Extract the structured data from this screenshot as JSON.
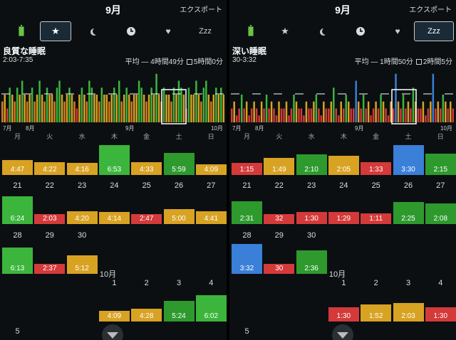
{
  "colors": {
    "green": "#3cb53c",
    "orange": "#d8a223",
    "red": "#d43a3a",
    "blue": "#3a7fd8",
    "dgreen": "#2e9a2e"
  },
  "icons": [
    "battery-icon",
    "star-icon",
    "moon-icon",
    "clock-icon",
    "heart-icon",
    "zzz-icon"
  ],
  "panels": [
    {
      "month": "9月",
      "export": "エクスポート",
      "toolbar_selected": 1,
      "zzz_label": "Zzz",
      "metric_title": "良質な睡眠",
      "range": "2:03-7:35",
      "avg_label": "平均 — 4時間49分",
      "check_label": "5時間0分",
      "chart_labels": [
        "7月",
        "8月",
        "9月",
        "10月"
      ],
      "chart_data": {
        "type": "bar",
        "palette": [
          "#3cb53c",
          "#d8a223",
          "#d87a23",
          "#d43a3a"
        ],
        "values": [
          3,
          4,
          2,
          5,
          4,
          3,
          5,
          4,
          6,
          4,
          3,
          4,
          5,
          3,
          4,
          6,
          4,
          3,
          5,
          4,
          4,
          3,
          5,
          6,
          4,
          3,
          4,
          5,
          4,
          3,
          2,
          4,
          5,
          4,
          3,
          6,
          5,
          4,
          4,
          3,
          5,
          4,
          4,
          3,
          4,
          5,
          4,
          6,
          3,
          4,
          5,
          4,
          3,
          4,
          4,
          6,
          5,
          4,
          3,
          4,
          5,
          4,
          7,
          4,
          3,
          5,
          4,
          4,
          3,
          5,
          4,
          6,
          5,
          4,
          2,
          5,
          4,
          4,
          6,
          4,
          3,
          5,
          6,
          4,
          3,
          4,
          5,
          4,
          5,
          4
        ],
        "ylim": [
          0,
          8
        ]
      },
      "daynames": [
        "月",
        "火",
        "水",
        "木",
        "金",
        "土",
        "日"
      ],
      "weeks": [
        {
          "days": [
            "",
            "",
            "",
            "",
            "",
            "",
            ""
          ],
          "values": [
            {
              "label": "4:47",
              "h": 0.47,
              "c": "orange"
            },
            {
              "label": "4:22",
              "h": 0.4,
              "c": "orange"
            },
            {
              "label": "4:16",
              "h": 0.38,
              "c": "orange"
            },
            {
              "label": "6:53",
              "h": 0.95,
              "c": "green"
            },
            {
              "label": "4:33",
              "h": 0.42,
              "c": "orange"
            },
            {
              "label": "5:59",
              "h": 0.7,
              "c": "dgreen"
            },
            {
              "label": "4:09",
              "h": 0.35,
              "c": "orange"
            }
          ]
        },
        {
          "days": [
            "21",
            "22",
            "23",
            "24",
            "25",
            "26",
            "27"
          ],
          "values": [
            {
              "label": "6:24",
              "h": 0.88,
              "c": "green"
            },
            {
              "label": "2:03",
              "h": 0.25,
              "c": "red"
            },
            {
              "label": "4:20",
              "h": 0.4,
              "c": "orange"
            },
            {
              "label": "4:14",
              "h": 0.38,
              "c": "orange"
            },
            {
              "label": "2:47",
              "h": 0.3,
              "c": "red"
            },
            {
              "label": "5:00",
              "h": 0.48,
              "c": "orange"
            },
            {
              "label": "4:41",
              "h": 0.42,
              "c": "orange"
            }
          ]
        },
        {
          "days": [
            "28",
            "29",
            "30",
            "",
            "",
            "",
            ""
          ],
          "values": [
            {
              "label": "6:13",
              "h": 0.85,
              "c": "green"
            },
            {
              "label": "2:37",
              "h": 0.28,
              "c": "red"
            },
            {
              "label": "5:12",
              "h": 0.6,
              "c": "orange"
            },
            null,
            null,
            null,
            null
          ]
        }
      ],
      "oct_label": "10月",
      "oct_days": [
        "1",
        "2",
        "3",
        "4"
      ],
      "oct_values": [
        {
          "label": "4:09",
          "h": 0.35,
          "c": "orange"
        },
        {
          "label": "4:28",
          "h": 0.4,
          "c": "orange"
        },
        {
          "label": "5:24",
          "h": 0.65,
          "c": "dgreen"
        },
        {
          "label": "6:02",
          "h": 0.85,
          "c": "green"
        }
      ],
      "next_day": "5"
    },
    {
      "month": "9月",
      "export": "エクスポート",
      "toolbar_selected": 5,
      "zzz_label": "Zzz",
      "metric_title": "深い睡眠",
      "range": "30-3:32",
      "avg_label": "平均 — 1時間50分",
      "check_label": "2時間5分",
      "chart_labels": [
        "7月",
        "8月",
        "9月",
        "10月"
      ],
      "chart_data": {
        "type": "bar",
        "palette": [
          "#3cb53c",
          "#d8a223",
          "#d43a3a",
          "#3a7fd8"
        ],
        "values": [
          2,
          3,
          1,
          2,
          4,
          2,
          3,
          1,
          2,
          3,
          2,
          1,
          3,
          2,
          4,
          2,
          3,
          2,
          1,
          3,
          2,
          2,
          3,
          1,
          2,
          4,
          3,
          2,
          2,
          1,
          3,
          2,
          2,
          3,
          4,
          2,
          1,
          3,
          2,
          2,
          3,
          5,
          2,
          1,
          3,
          2,
          4,
          3,
          2,
          2,
          6,
          3,
          2,
          4,
          2,
          3,
          1,
          2,
          3,
          2,
          4,
          3,
          2,
          1,
          3,
          2,
          7,
          3,
          2,
          4,
          2,
          3,
          2,
          5,
          3,
          2,
          2,
          3,
          1,
          2,
          3,
          7,
          2,
          3,
          2,
          4,
          3,
          2,
          3,
          2
        ],
        "ylim": [
          0,
          8
        ]
      },
      "daynames": [
        "月",
        "火",
        "水",
        "木",
        "金",
        "土",
        "日"
      ],
      "weeks": [
        {
          "days": [
            "",
            "",
            "",
            "",
            "",
            "",
            ""
          ],
          "values": [
            {
              "label": "1:15",
              "h": 0.38,
              "c": "red"
            },
            {
              "label": "1:49",
              "h": 0.55,
              "c": "orange"
            },
            {
              "label": "2:10",
              "h": 0.65,
              "c": "dgreen"
            },
            {
              "label": "2:05",
              "h": 0.62,
              "c": "orange"
            },
            {
              "label": "1:33",
              "h": 0.4,
              "c": "red"
            },
            {
              "label": "3:30",
              "h": 0.95,
              "c": "blue"
            },
            {
              "label": "2:15",
              "h": 0.68,
              "c": "dgreen"
            }
          ]
        },
        {
          "days": [
            "21",
            "22",
            "23",
            "24",
            "25",
            "26",
            "27"
          ],
          "values": [
            {
              "label": "2:31",
              "h": 0.72,
              "c": "dgreen"
            },
            {
              "label": "32",
              "h": 0.3,
              "c": "red"
            },
            {
              "label": "1:30",
              "h": 0.38,
              "c": "red"
            },
            {
              "label": "1:29",
              "h": 0.38,
              "c": "red"
            },
            {
              "label": "1:11",
              "h": 0.35,
              "c": "red"
            },
            {
              "label": "2:25",
              "h": 0.7,
              "c": "dgreen"
            },
            {
              "label": "2:08",
              "h": 0.65,
              "c": "dgreen"
            }
          ]
        },
        {
          "days": [
            "28",
            "29",
            "30",
            "",
            "",
            "",
            ""
          ],
          "values": [
            {
              "label": "3:32",
              "h": 0.95,
              "c": "blue"
            },
            {
              "label": "30",
              "h": 0.3,
              "c": "red"
            },
            {
              "label": "2:36",
              "h": 0.75,
              "c": "dgreen"
            },
            null,
            null,
            null,
            null
          ]
        }
      ],
      "oct_label": "10月",
      "oct_days": [
        "1",
        "2",
        "3",
        "4"
      ],
      "oct_values": [
        {
          "label": "1:30",
          "h": 0.45,
          "c": "red"
        },
        {
          "label": "1:52",
          "h": 0.55,
          "c": "orange"
        },
        {
          "label": "2:03",
          "h": 0.6,
          "c": "orange"
        },
        {
          "label": "1:30",
          "h": 0.45,
          "c": "red"
        }
      ],
      "next_day": "5"
    }
  ]
}
